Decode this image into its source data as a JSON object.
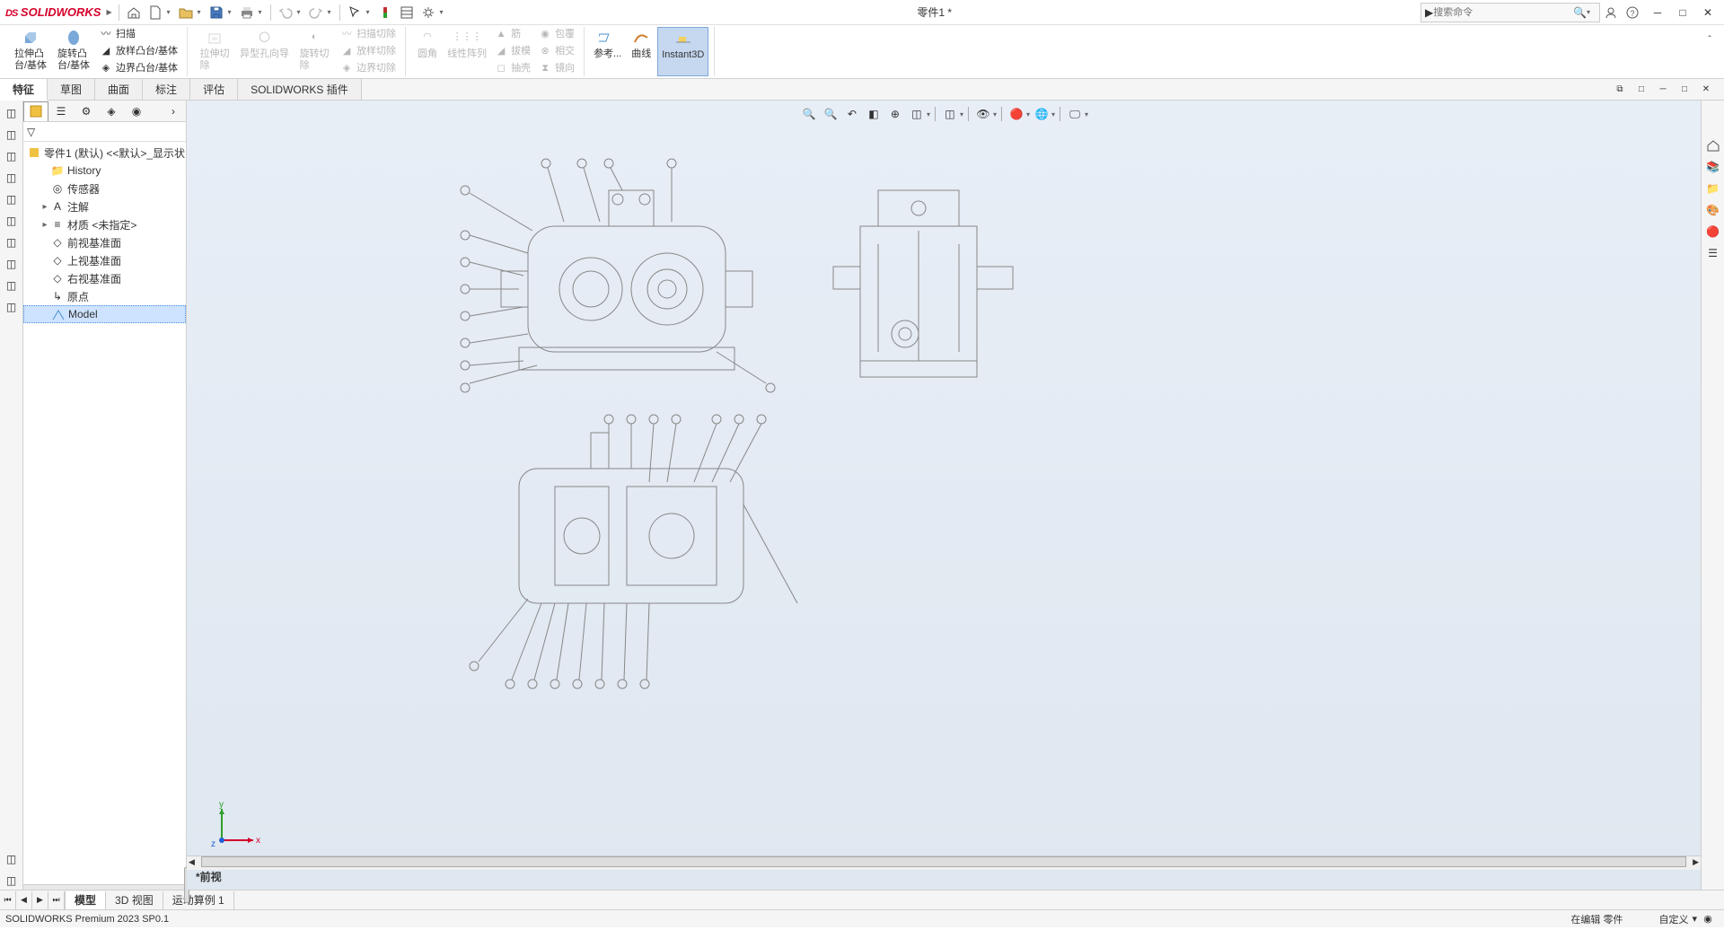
{
  "app": {
    "name": "SOLIDWORKS",
    "logo_prefix": "DS"
  },
  "document_title": "零件1 *",
  "search": {
    "placeholder": "搜索命令"
  },
  "ribbon": {
    "extrude_boss": "拉伸凸\n台/基体",
    "revolve_boss": "旋转凸\n台/基体",
    "sweep": "扫描",
    "loft_boss": "放样凸台/基体",
    "boundary_boss": "边界凸台/基体",
    "extruded_cut": "拉伸切\n除",
    "hole_wizard": "异型孔向导",
    "revolved_cut": "旋转切\n除",
    "swept_cut": "扫描切除",
    "lofted_cut": "放样切除",
    "boundary_cut": "边界切除",
    "fillet": "圆角",
    "linear_pattern": "线性阵列",
    "rib": "筋",
    "draft": "拔模",
    "shell": "抽壳",
    "wrap": "包覆",
    "intersect": "相交",
    "mirror": "镜向",
    "ref_geom": "参考...",
    "curves": "曲线",
    "instant3d": "Instant3D"
  },
  "command_tabs": [
    "特征",
    "草图",
    "曲面",
    "标注",
    "评估",
    "SOLIDWORKS 插件"
  ],
  "active_command_tab": 0,
  "feature_tree": {
    "root": "零件1 (默认) <<默认>_显示状",
    "items": [
      {
        "label": "History",
        "icon": "folder"
      },
      {
        "label": "传感器",
        "icon": "sensor"
      },
      {
        "label": "注解",
        "icon": "annotation",
        "expandable": true
      },
      {
        "label": "材质 <未指定>",
        "icon": "material",
        "expandable": true
      },
      {
        "label": "前视基准面",
        "icon": "plane"
      },
      {
        "label": "上视基准面",
        "icon": "plane"
      },
      {
        "label": "右视基准面",
        "icon": "plane"
      },
      {
        "label": "原点",
        "icon": "origin"
      },
      {
        "label": "Model",
        "icon": "sketch",
        "selected": true
      }
    ]
  },
  "view_label": "*前视",
  "bottom_tabs": [
    "模型",
    "3D 视图",
    "运动算例 1"
  ],
  "active_bottom_tab": 0,
  "status": {
    "left": "SOLIDWORKS Premium 2023 SP0.1",
    "mode": "在编辑 零件",
    "custom": "自定义"
  },
  "triad": {
    "x": "x",
    "y": "y",
    "z": "z"
  },
  "colors": {
    "accent": "#d4002a",
    "x_axis": "#d4002a",
    "y_axis": "#2e9e2e",
    "z_axis": "#1e5fd6"
  }
}
